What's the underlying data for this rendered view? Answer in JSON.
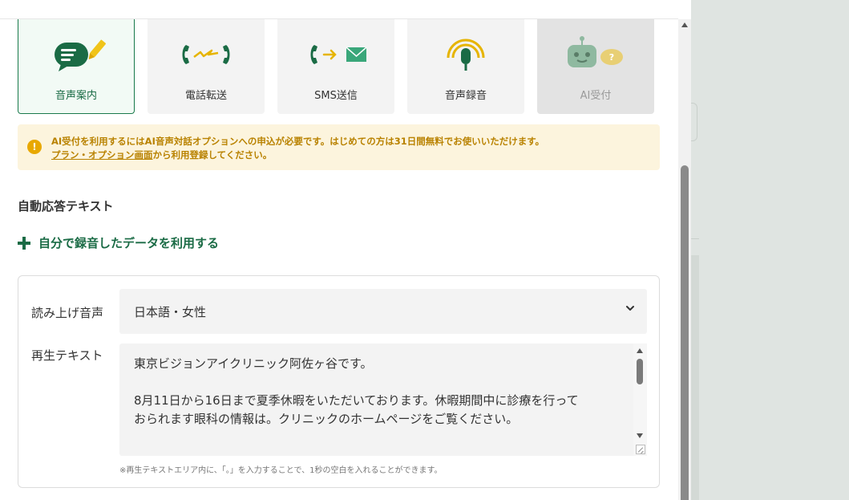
{
  "tiles": [
    {
      "label": "音声案内",
      "icon": "speech-bubble-pencil-icon",
      "state": "selected"
    },
    {
      "label": "電話転送",
      "icon": "phone-transfer-icon",
      "state": "normal"
    },
    {
      "label": "SMS送信",
      "icon": "phone-to-mail-icon",
      "state": "normal"
    },
    {
      "label": "音声録音",
      "icon": "microphone-icon",
      "state": "normal"
    },
    {
      "label": "AI受付",
      "icon": "robot-icon",
      "state": "disabled"
    }
  ],
  "notice": {
    "line1": "AI受付を利用するにはAI音声対話オプションへの申込が必要です。はじめての方は31日間無料でお使いいただけます。",
    "link": "プラン・オプション画面",
    "line2_rest": "から利用登録してください。"
  },
  "section": {
    "title": "自動応答テキスト",
    "add_link": "自分で録音したデータを利用する"
  },
  "form": {
    "voice_label": "読み上げ音声",
    "voice_value": "日本語・女性",
    "text_label": "再生テキスト",
    "text_line1": "東京ビジョンアイクリニック阿佐ヶ谷です。",
    "text_line2": "8月11日から16日まで夏季休暇をいただいております。休暇期間中に診療を行って",
    "text_line3": "おられます眼科の情報は。クリニックのホームページをご覧ください。",
    "hint": "※再生テキストエリア内に、「。」を入力することで、1秒の空白を入れることができます。"
  },
  "colors": {
    "brand_green": "#1a6b45",
    "notice_bg": "#fcf4dd",
    "notice_text": "#b98200",
    "warning_icon": "#e8a800"
  }
}
